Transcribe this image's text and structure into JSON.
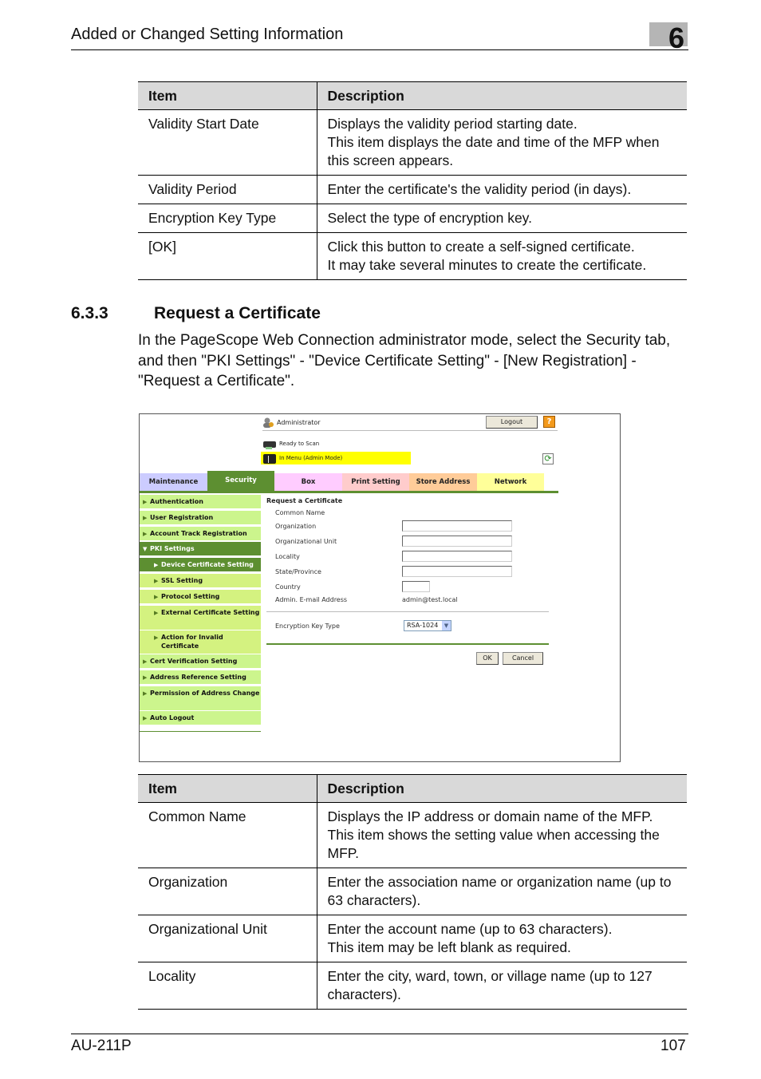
{
  "header": {
    "title": "Added or Changed Setting Information",
    "chapter": "6"
  },
  "table1": {
    "columns": [
      "Item",
      "Description"
    ],
    "rows": [
      {
        "item": "Validity Start Date",
        "desc": [
          "Displays the validity period starting date.",
          "This item displays the date and time of the MFP when this screen appears."
        ]
      },
      {
        "item": "Validity Period",
        "desc": [
          "Enter the certificate's the validity period (in days)."
        ]
      },
      {
        "item": "Encryption Key Type",
        "desc": [
          "Select the type of encryption key."
        ]
      },
      {
        "item": "[OK]",
        "desc": [
          "Click this button to create a self-signed certificate.",
          "It may take several minutes to create the certificate."
        ]
      }
    ]
  },
  "section": {
    "number": "6.3.3",
    "title": "Request a Certificate",
    "paragraph": "In the PageScope Web Connection administrator mode, select the Security tab, and then \"PKI Settings\" - \"Device Certificate Setting\" - [New Registration] - \"Request a Certificate\"."
  },
  "screenshot": {
    "user": "Administrator",
    "logout_label": "Logout",
    "help_label": "?",
    "status1": "Ready to Scan",
    "status2": "In Menu (Admin Mode)",
    "colors": {
      "highlight": "#ffff00",
      "accent": "#5d8f31"
    },
    "tabs": [
      {
        "label": "Maintenance",
        "color": "#ccccff"
      },
      {
        "label": "Security",
        "color": "#5d8f31"
      },
      {
        "label": "Box",
        "color": "#ffccff"
      },
      {
        "label": "Print Setting",
        "color": "#ffcccc"
      },
      {
        "label": "Store Address",
        "color": "#ffcc99"
      },
      {
        "label": "Network",
        "color": "#ffff99"
      }
    ],
    "nav": [
      {
        "label": "Authentication",
        "level": "top"
      },
      {
        "label": "User Registration",
        "level": "top"
      },
      {
        "label": "Account Track Registration",
        "level": "top"
      },
      {
        "label": "PKI Settings",
        "level": "open"
      },
      {
        "label": "Device Certificate Setting",
        "level": "sub-active"
      },
      {
        "label": "SSL Setting",
        "level": "sub"
      },
      {
        "label": "Protocol Setting",
        "level": "sub"
      },
      {
        "label": "External Certificate Setting",
        "level": "sub"
      },
      {
        "label": "Action for Invalid Certificate",
        "level": "sub"
      },
      {
        "label": "Cert Verification Setting",
        "level": "top"
      },
      {
        "label": "Address Reference Setting",
        "level": "top"
      },
      {
        "label": "Permission of Address Change",
        "level": "top"
      },
      {
        "label": "Auto Logout",
        "level": "top"
      }
    ],
    "form": {
      "title": "Request a Certificate",
      "fields": [
        {
          "label": "Common Name",
          "value": ""
        },
        {
          "label": "Organization",
          "value": ""
        },
        {
          "label": "Organizational Unit",
          "value": ""
        },
        {
          "label": "Locality",
          "value": ""
        },
        {
          "label": "State/Province",
          "value": ""
        },
        {
          "label": "Country",
          "value": ""
        },
        {
          "label": "Admin. E-mail Address",
          "value": "admin@test.local"
        }
      ],
      "key_type_label": "Encryption Key Type",
      "key_type_value": "RSA-1024",
      "ok_label": "OK",
      "cancel_label": "Cancel"
    }
  },
  "table2": {
    "columns": [
      "Item",
      "Description"
    ],
    "rows": [
      {
        "item": "Common Name",
        "desc": [
          "Displays the IP address or domain name of the MFP.",
          "This item shows the setting value when accessing the MFP."
        ]
      },
      {
        "item": "Organization",
        "desc": [
          "Enter the association name or organization name (up to 63 characters)."
        ]
      },
      {
        "item": "Organizational Unit",
        "desc": [
          "Enter the account name (up to 63 characters).",
          "This item may be left blank as required."
        ]
      },
      {
        "item": "Locality",
        "desc": [
          "Enter the city, ward, town, or village name (up to 127 characters)."
        ]
      }
    ]
  },
  "footer": {
    "model": "AU-211P",
    "page": "107"
  }
}
